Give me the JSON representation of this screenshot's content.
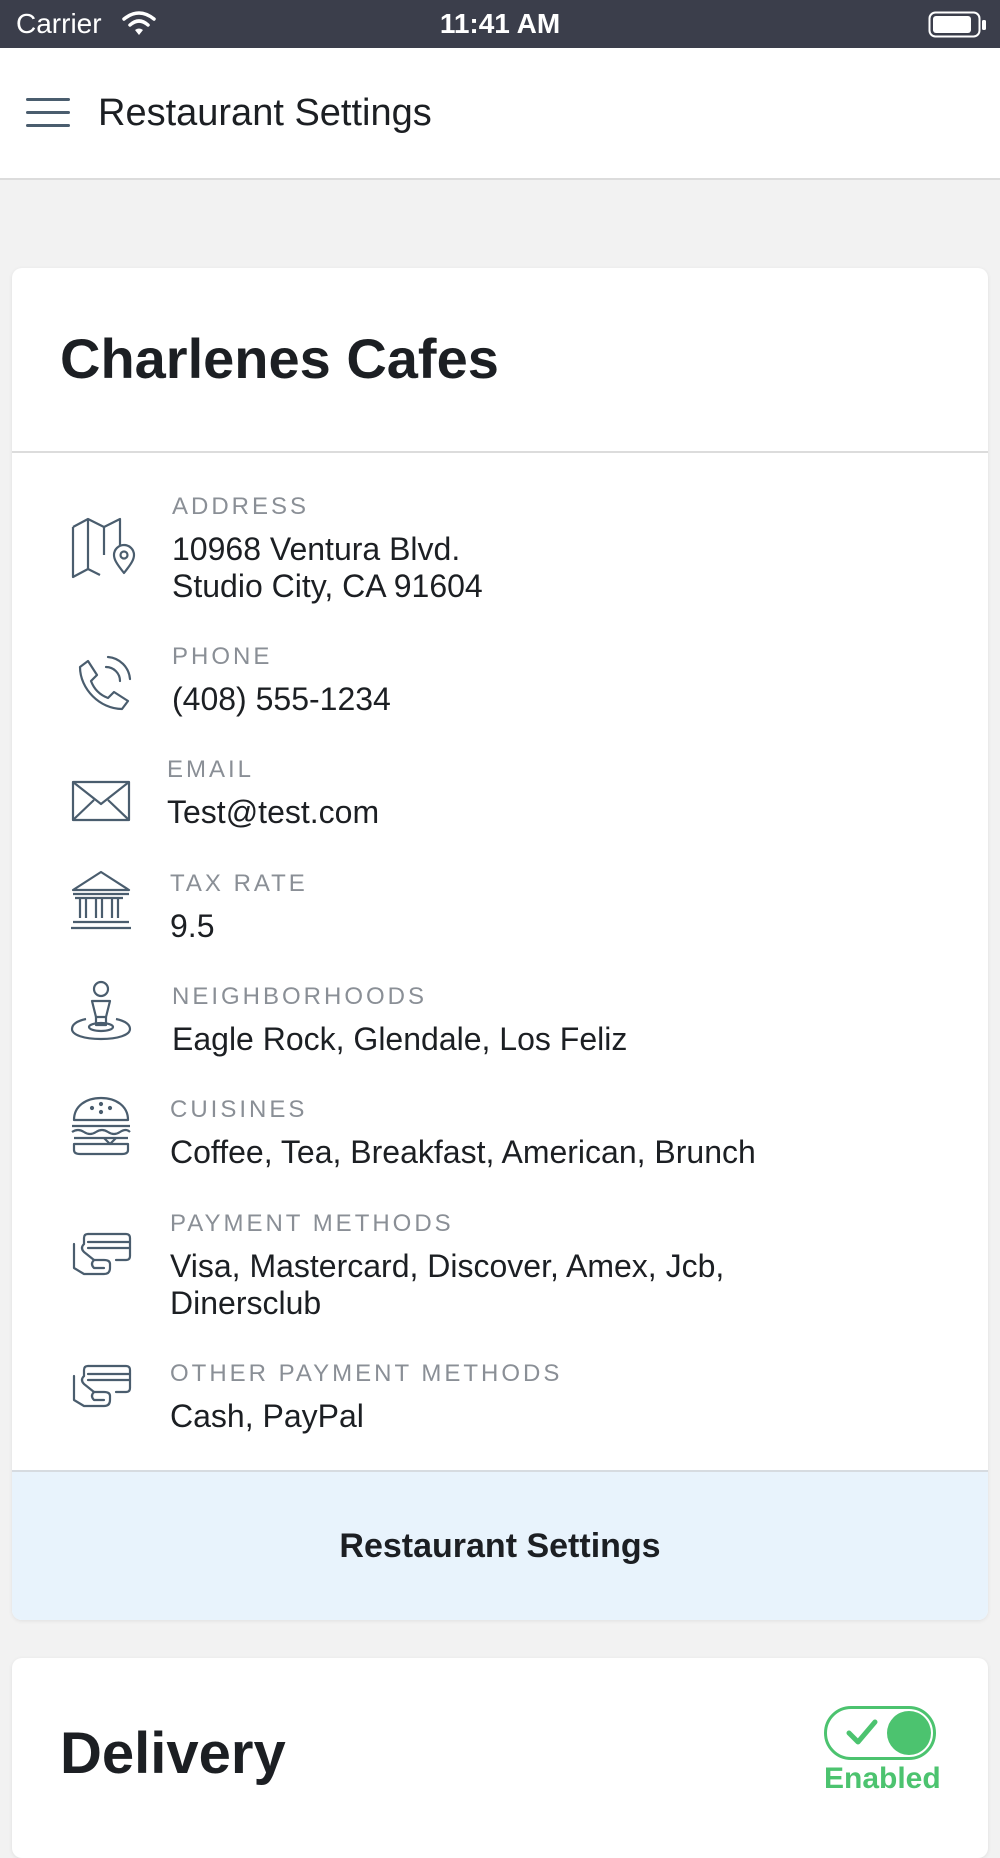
{
  "status_bar": {
    "carrier": "Carrier",
    "time": "11:41 AM"
  },
  "nav": {
    "title": "Restaurant Settings"
  },
  "restaurant": {
    "name": "Charlenes Cafes",
    "fields": {
      "address": {
        "label": "ADDRESS",
        "line1": "10968 Ventura Blvd.",
        "line2": "Studio City, CA 91604",
        "icon": "map-pin-icon"
      },
      "phone": {
        "label": "PHONE",
        "value": "(408) 555-1234",
        "icon": "phone-icon"
      },
      "email": {
        "label": "EMAIL",
        "value": "Test@test.com",
        "icon": "envelope-icon"
      },
      "tax_rate": {
        "label": "TAX RATE",
        "value": "9.5",
        "icon": "bank-icon"
      },
      "neighborhoods": {
        "label": "NEIGHBORHOODS",
        "value": "Eagle Rock, Glendale, Los Feliz",
        "icon": "location-person-icon"
      },
      "cuisines": {
        "label": "CUISINES",
        "value": "Coffee, Tea, Breakfast, American, Brunch",
        "icon": "burger-icon"
      },
      "payment_methods": {
        "label": "PAYMENT METHODS",
        "line1": "Visa, Mastercard, Discover, Amex, Jcb,",
        "line2": "Dinersclub",
        "icon": "card-hand-icon"
      },
      "other_payment_methods": {
        "label": "OTHER PAYMENT METHODS",
        "value": "Cash, PayPal",
        "icon": "card-hand-icon"
      }
    },
    "footer_button": "Restaurant Settings"
  },
  "delivery": {
    "title": "Delivery",
    "toggle_label": "Enabled",
    "enabled": true
  },
  "colors": {
    "status_bar_bg": "#3b3e4b",
    "accent_green": "#4cc36f",
    "footer_bg": "#e8f3fc",
    "icon_stroke": "#4a5d6e"
  }
}
